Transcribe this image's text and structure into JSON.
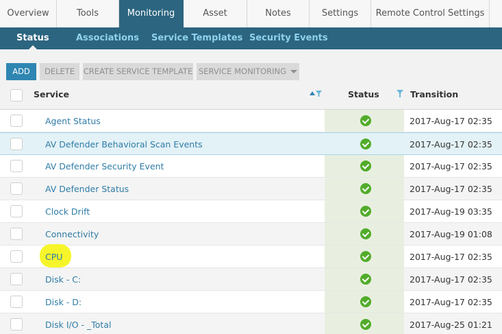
{
  "tabs": [
    {
      "label": "Overview"
    },
    {
      "label": "Tools"
    },
    {
      "label": "Monitoring",
      "active": true
    },
    {
      "label": "Asset"
    },
    {
      "label": "Notes"
    },
    {
      "label": "Settings"
    },
    {
      "label": "Remote Control Settings"
    },
    {
      "label": ""
    }
  ],
  "subnav": [
    {
      "label": "Status",
      "active": true
    },
    {
      "label": "Associations"
    },
    {
      "label": "Service Templates"
    },
    {
      "label": "Security Events"
    }
  ],
  "toolbar": {
    "add_label": "ADD",
    "delete_label": "DELETE",
    "create_template_label": "CREATE SERVICE TEMPLATE",
    "service_monitoring_label": "SERVICE MONITORING"
  },
  "table": {
    "columns": {
      "service": "Service",
      "status": "Status",
      "transition": "Transition"
    },
    "rows": [
      {
        "service": "Agent Status",
        "status": "ok",
        "transition": "2017-Aug-17 02:35"
      },
      {
        "service": "AV Defender Behavioral Scan Events",
        "status": "ok",
        "transition": "2017-Aug-17 02:35",
        "selected": true
      },
      {
        "service": "AV Defender Security Event",
        "status": "ok",
        "transition": "2017-Aug-17 02:35"
      },
      {
        "service": "AV Defender Status",
        "status": "ok",
        "transition": "2017-Aug-17 02:35"
      },
      {
        "service": "Clock Drift",
        "status": "ok",
        "transition": "2017-Aug-19 03:35"
      },
      {
        "service": "Connectivity",
        "status": "ok",
        "transition": "2017-Aug-19 01:08"
      },
      {
        "service": "CPU",
        "status": "ok",
        "transition": "2017-Aug-17 02:35",
        "highlighted": true
      },
      {
        "service": "Disk - C:",
        "status": "ok",
        "transition": "2017-Aug-17 02:35"
      },
      {
        "service": "Disk - D:",
        "status": "ok",
        "transition": "2017-Aug-17 02:35"
      },
      {
        "service": "Disk I/O - _Total",
        "status": "ok",
        "transition": "2017-Aug-25 01:21"
      }
    ]
  },
  "colors": {
    "nav_bg": "#2c6580",
    "subnav_text": "#8fd2ec",
    "add_button": "#2f86b2",
    "status_ok": "#52ac2a",
    "link": "#2f7ca6",
    "highlight": "#f5f52c"
  }
}
